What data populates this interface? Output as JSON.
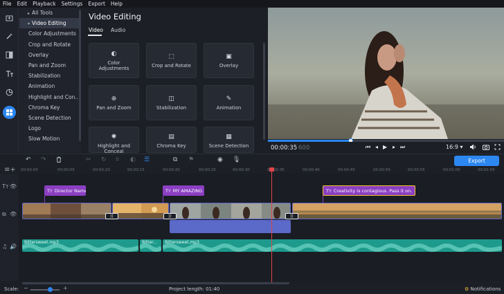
{
  "menu": [
    "File",
    "Edit",
    "Playback",
    "Settings",
    "Export",
    "Help"
  ],
  "sidebar": {
    "items": [
      {
        "label": "All Tools",
        "arrow": "▸"
      },
      {
        "label": "Video Editing",
        "arrow": "▾"
      },
      {
        "label": "Color Adjustments"
      },
      {
        "label": "Crop and Rotate"
      },
      {
        "label": "Overlay"
      },
      {
        "label": "Pan and Zoom"
      },
      {
        "label": "Stabilization"
      },
      {
        "label": "Animation"
      },
      {
        "label": "Highlight and Conc..."
      },
      {
        "label": "Chroma Key"
      },
      {
        "label": "Scene Detection"
      },
      {
        "label": "Logo"
      },
      {
        "label": "Slow Motion"
      }
    ]
  },
  "panel": {
    "title": "Video Editing",
    "tabs": [
      "Video",
      "Audio"
    ],
    "tiles": [
      {
        "icon": "◐",
        "label": "Color Adjustments"
      },
      {
        "icon": "⬚",
        "label": "Crop and Rotate"
      },
      {
        "icon": "▣",
        "label": "Overlay"
      },
      {
        "icon": "⊕",
        "label": "Pan and Zoom"
      },
      {
        "icon": "◫",
        "label": "Stabilization"
      },
      {
        "icon": "✎",
        "label": "Animation"
      },
      {
        "icon": "✺",
        "label": "Highlight and Conceal"
      },
      {
        "icon": "▤",
        "label": "Chroma Key"
      },
      {
        "icon": "▦",
        "label": "Scene Detection"
      }
    ]
  },
  "player": {
    "time": "00:00:35",
    "frames": "600",
    "aspect": "16:9 ▾",
    "progress": 0.35
  },
  "toolbar": {
    "export_label": "Export"
  },
  "ruler": [
    "00:00:00",
    "00:00:05",
    "00:00:10",
    "00:00:15",
    "00:00:20",
    "00:00:25",
    "00:00:30",
    "00:00:35",
    "00:00:40",
    "00:00:45",
    "00:00:50",
    "00:00:55",
    "00:01:00",
    "00:01:05"
  ],
  "timeline": {
    "titles": [
      "Director Name",
      "MY AMAZING",
      "Creativity is contagious. Pass it on."
    ],
    "audio": [
      "Bittersweet.mp3",
      "Bitter...",
      "Bittersweet.mp3"
    ]
  },
  "status": {
    "scale_label": "Scale:",
    "project_length": "Project length:  01:40",
    "notifications": "Notifications"
  },
  "colors": {
    "accent": "#2c87f0",
    "title_clip": "#8b3fc2",
    "audio_clip": "#1d9a8c",
    "playhead": "#e0444a"
  }
}
